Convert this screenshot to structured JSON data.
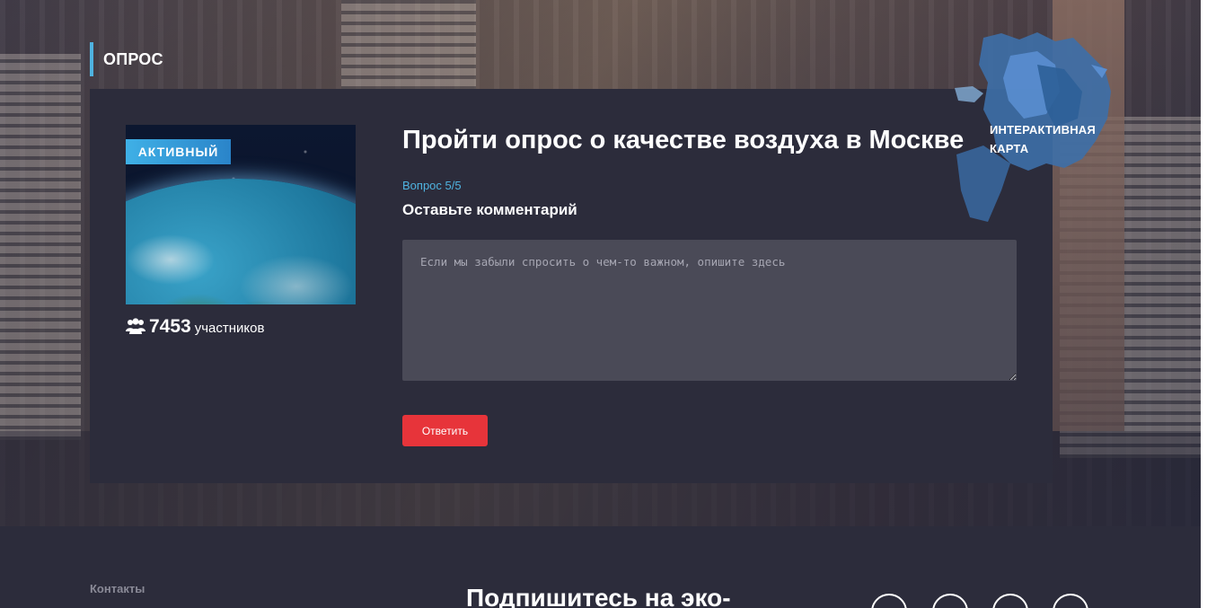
{
  "section": {
    "title": "ОПРОС"
  },
  "poll": {
    "status_badge": "АКТИВНЫЙ",
    "participants_count": "7453",
    "participants_label": "участников",
    "title": "Пройти опрос о качестве воздуха в Москве",
    "question_counter": "Вопрос 5/5",
    "question_text": "Оставьте комментарий",
    "comment_placeholder": "Если мы забыли спросить о чем-то важном, опишите здесь",
    "comment_value": "",
    "submit_label": "Ответить",
    "image_icon": "earth-from-space-image"
  },
  "map_widget": {
    "label_line1": "ИНТЕРАКТИВНАЯ",
    "label_line2": "КАРТА",
    "icon": "moscow-map-icon"
  },
  "footer": {
    "contacts_label": "Контакты",
    "subscribe_title": "Подпишитесь на эко-",
    "social_icons": [
      "vk-icon",
      "telegram-icon",
      "youtube-icon",
      "twitter-icon"
    ]
  },
  "colors": {
    "accent_blue": "#4fb3e0",
    "button_red": "#e7343a",
    "card_bg": "#2c2c3b",
    "textarea_bg": "#4a4a57"
  }
}
